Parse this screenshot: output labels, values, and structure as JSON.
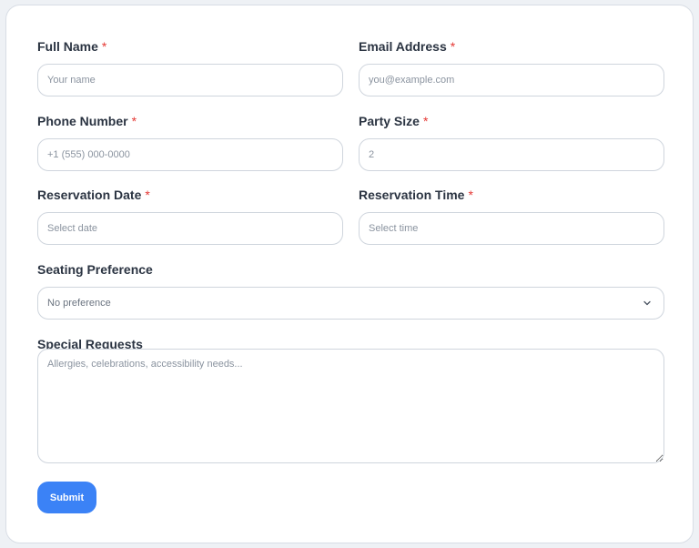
{
  "form": {
    "full_name": {
      "label": "Full Name",
      "required_mark": "*",
      "placeholder": "Your name",
      "value": ""
    },
    "email": {
      "label": "Email Address",
      "required_mark": "*",
      "placeholder": "you@example.com",
      "value": ""
    },
    "phone": {
      "label": "Phone Number",
      "required_mark": "*",
      "placeholder": "+1 (555) 000-0000",
      "value": ""
    },
    "party_size": {
      "label": "Party Size",
      "required_mark": "*",
      "placeholder": "2",
      "value": ""
    },
    "reservation_date": {
      "label": "Reservation Date",
      "required_mark": "*",
      "placeholder": "Select date",
      "value": ""
    },
    "reservation_time": {
      "label": "Reservation Time",
      "required_mark": "*",
      "placeholder": "Select time",
      "value": ""
    },
    "seating": {
      "label": "Seating Preference",
      "selected": "No preference",
      "icon": "chevron-down-icon"
    },
    "special_requests": {
      "label": "Special Requests",
      "placeholder": "Allergies, celebrations, accessibility needs...",
      "value": ""
    },
    "submit_label": "Submit"
  },
  "colors": {
    "accent": "#3b82f6",
    "required": "#e53935",
    "border": "#cfd5dd",
    "label": "#2b3442",
    "placeholder": "#8a939f"
  }
}
